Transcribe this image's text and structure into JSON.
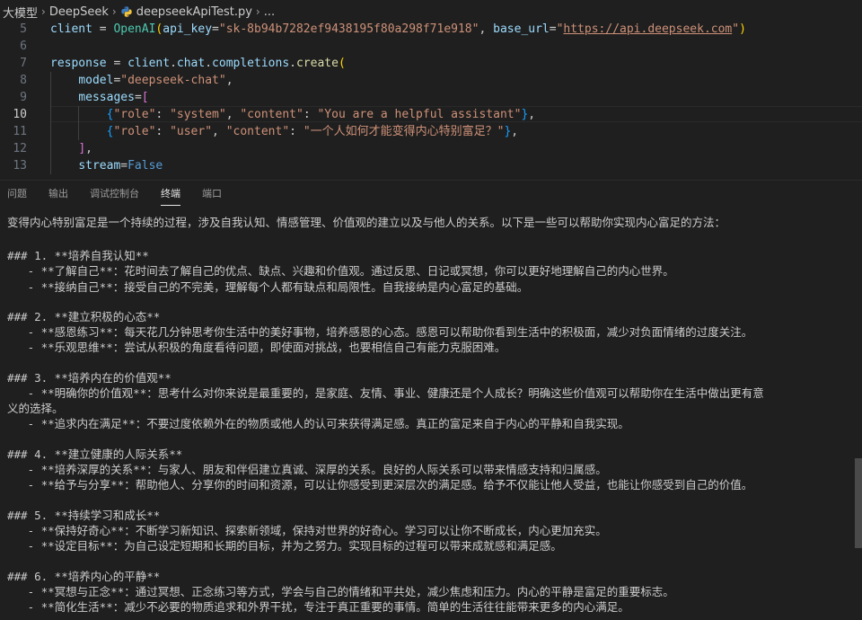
{
  "breadcrumb": {
    "items": [
      "大模型",
      "DeepSeek",
      "deepseekApiTest.py",
      "..."
    ],
    "separator": "›"
  },
  "editor": {
    "lines": [
      {
        "num": "5",
        "tokens": [
          {
            "t": "client",
            "c": "var"
          },
          {
            "t": " = ",
            "c": "pun"
          },
          {
            "t": "OpenAI",
            "c": "cls"
          },
          {
            "t": "(",
            "c": "b1"
          },
          {
            "t": "api_key",
            "c": "var"
          },
          {
            "t": "=",
            "c": "pun"
          },
          {
            "t": "\"sk-8b94b7282ef9438195f80a298f71e918\"",
            "c": "str"
          },
          {
            "t": ", ",
            "c": "pun"
          },
          {
            "t": "base_url",
            "c": "var"
          },
          {
            "t": "=",
            "c": "pun"
          },
          {
            "t": "\"",
            "c": "str"
          },
          {
            "t": "https://api.deepseek.com",
            "c": "url"
          },
          {
            "t": "\"",
            "c": "str"
          },
          {
            "t": ")",
            "c": "b1"
          }
        ]
      },
      {
        "num": "6",
        "tokens": []
      },
      {
        "num": "7",
        "tokens": [
          {
            "t": "response",
            "c": "var"
          },
          {
            "t": " = ",
            "c": "pun"
          },
          {
            "t": "client",
            "c": "var"
          },
          {
            "t": ".",
            "c": "pun"
          },
          {
            "t": "chat",
            "c": "var"
          },
          {
            "t": ".",
            "c": "pun"
          },
          {
            "t": "completions",
            "c": "var"
          },
          {
            "t": ".",
            "c": "pun"
          },
          {
            "t": "create",
            "c": "fn"
          },
          {
            "t": "(",
            "c": "b1"
          }
        ]
      },
      {
        "num": "8",
        "tokens": [
          {
            "t": "    ",
            "c": "pun"
          },
          {
            "t": "model",
            "c": "var"
          },
          {
            "t": "=",
            "c": "pun"
          },
          {
            "t": "\"deepseek-chat\"",
            "c": "str"
          },
          {
            "t": ",",
            "c": "pun"
          }
        ]
      },
      {
        "num": "9",
        "tokens": [
          {
            "t": "    ",
            "c": "pun"
          },
          {
            "t": "messages",
            "c": "var"
          },
          {
            "t": "=",
            "c": "pun"
          },
          {
            "t": "[",
            "c": "b2"
          }
        ]
      },
      {
        "num": "10",
        "tokens": [
          {
            "t": "        ",
            "c": "pun"
          },
          {
            "t": "{",
            "c": "b3"
          },
          {
            "t": "\"role\"",
            "c": "str"
          },
          {
            "t": ": ",
            "c": "pun"
          },
          {
            "t": "\"system\"",
            "c": "str"
          },
          {
            "t": ", ",
            "c": "pun"
          },
          {
            "t": "\"content\"",
            "c": "str"
          },
          {
            "t": ": ",
            "c": "pun"
          },
          {
            "t": "\"You are a helpful assistant\"",
            "c": "str"
          },
          {
            "t": "}",
            "c": "b3"
          },
          {
            "t": ",",
            "c": "pun"
          }
        ]
      },
      {
        "num": "11",
        "tokens": [
          {
            "t": "        ",
            "c": "pun"
          },
          {
            "t": "{",
            "c": "b3"
          },
          {
            "t": "\"role\"",
            "c": "str"
          },
          {
            "t": ": ",
            "c": "pun"
          },
          {
            "t": "\"user\"",
            "c": "str"
          },
          {
            "t": ", ",
            "c": "pun"
          },
          {
            "t": "\"content\"",
            "c": "str"
          },
          {
            "t": ": ",
            "c": "pun"
          },
          {
            "t": "\"一个人如何才能变得内心特别富足？\"",
            "c": "str"
          },
          {
            "t": "}",
            "c": "b3"
          },
          {
            "t": ",",
            "c": "pun"
          }
        ]
      },
      {
        "num": "12",
        "tokens": [
          {
            "t": "    ",
            "c": "pun"
          },
          {
            "t": "]",
            "c": "b2"
          },
          {
            "t": ",",
            "c": "pun"
          }
        ]
      },
      {
        "num": "13",
        "tokens": [
          {
            "t": "    ",
            "c": "pun"
          },
          {
            "t": "stream",
            "c": "var"
          },
          {
            "t": "=",
            "c": "pun"
          },
          {
            "t": "False",
            "c": "kw"
          }
        ]
      }
    ]
  },
  "panel": {
    "tabs": [
      {
        "label": "问题",
        "active": false
      },
      {
        "label": "输出",
        "active": false
      },
      {
        "label": "调试控制台",
        "active": false
      },
      {
        "label": "终端",
        "active": true
      },
      {
        "label": "端口",
        "active": false
      }
    ]
  },
  "terminal": {
    "lines": [
      "变得内心特别富足是一个持续的过程，涉及自我认知、情感管理、价值观的建立以及与他人的关系。以下是一些可以帮助你实现内心富足的方法：",
      "",
      "### 1. **培养自我认知**",
      "   - **了解自己**：花时间去了解自己的优点、缺点、兴趣和价值观。通过反思、日记或冥想，你可以更好地理解自己的内心世界。",
      "   - **接纳自己**：接受自己的不完美，理解每个人都有缺点和局限性。自我接纳是内心富足的基础。",
      "",
      "### 2. **建立积极的心态**",
      "   - **感恩练习**：每天花几分钟思考你生活中的美好事物，培养感恩的心态。感恩可以帮助你看到生活中的积极面，减少对负面情绪的过度关注。",
      "   - **乐观思维**：尝试从积极的角度看待问题，即使面对挑战，也要相信自己有能力克服困难。",
      "",
      "### 3. **培养内在的价值观**",
      "   - **明确你的价值观**：思考什么对你来说是最重要的，是家庭、友情、事业、健康还是个人成长？明确这些价值观可以帮助你在生活中做出更有意",
      "义的选择。",
      "   - **追求内在满足**：不要过度依赖外在的物质或他人的认可来获得满足感。真正的富足来自于内心的平静和自我实现。",
      "",
      "### 4. **建立健康的人际关系**",
      "   - **培养深厚的关系**：与家人、朋友和伴侣建立真诚、深厚的关系。良好的人际关系可以带来情感支持和归属感。",
      "   - **给予与分享**：帮助他人、分享你的时间和资源，可以让你感受到更深层次的满足感。给予不仅能让他人受益，也能让你感受到自己的价值。",
      "",
      "### 5. **持续学习和成长**",
      "   - **保持好奇心**：不断学习新知识、探索新领域，保持对世界的好奇心。学习可以让你不断成长，内心更加充实。",
      "   - **设定目标**：为自己设定短期和长期的目标，并为之努力。实现目标的过程可以带来成就感和满足感。",
      "",
      "### 6. **培养内心的平静**",
      "   - **冥想与正念**：通过冥想、正念练习等方式，学会与自己的情绪和平共处，减少焦虑和压力。内心的平静是富足的重要标志。",
      "   - **简化生活**：减少不必要的物质追求和外界干扰，专注于真正重要的事情。简单的生活往往能带来更多的内心满足。"
    ]
  }
}
